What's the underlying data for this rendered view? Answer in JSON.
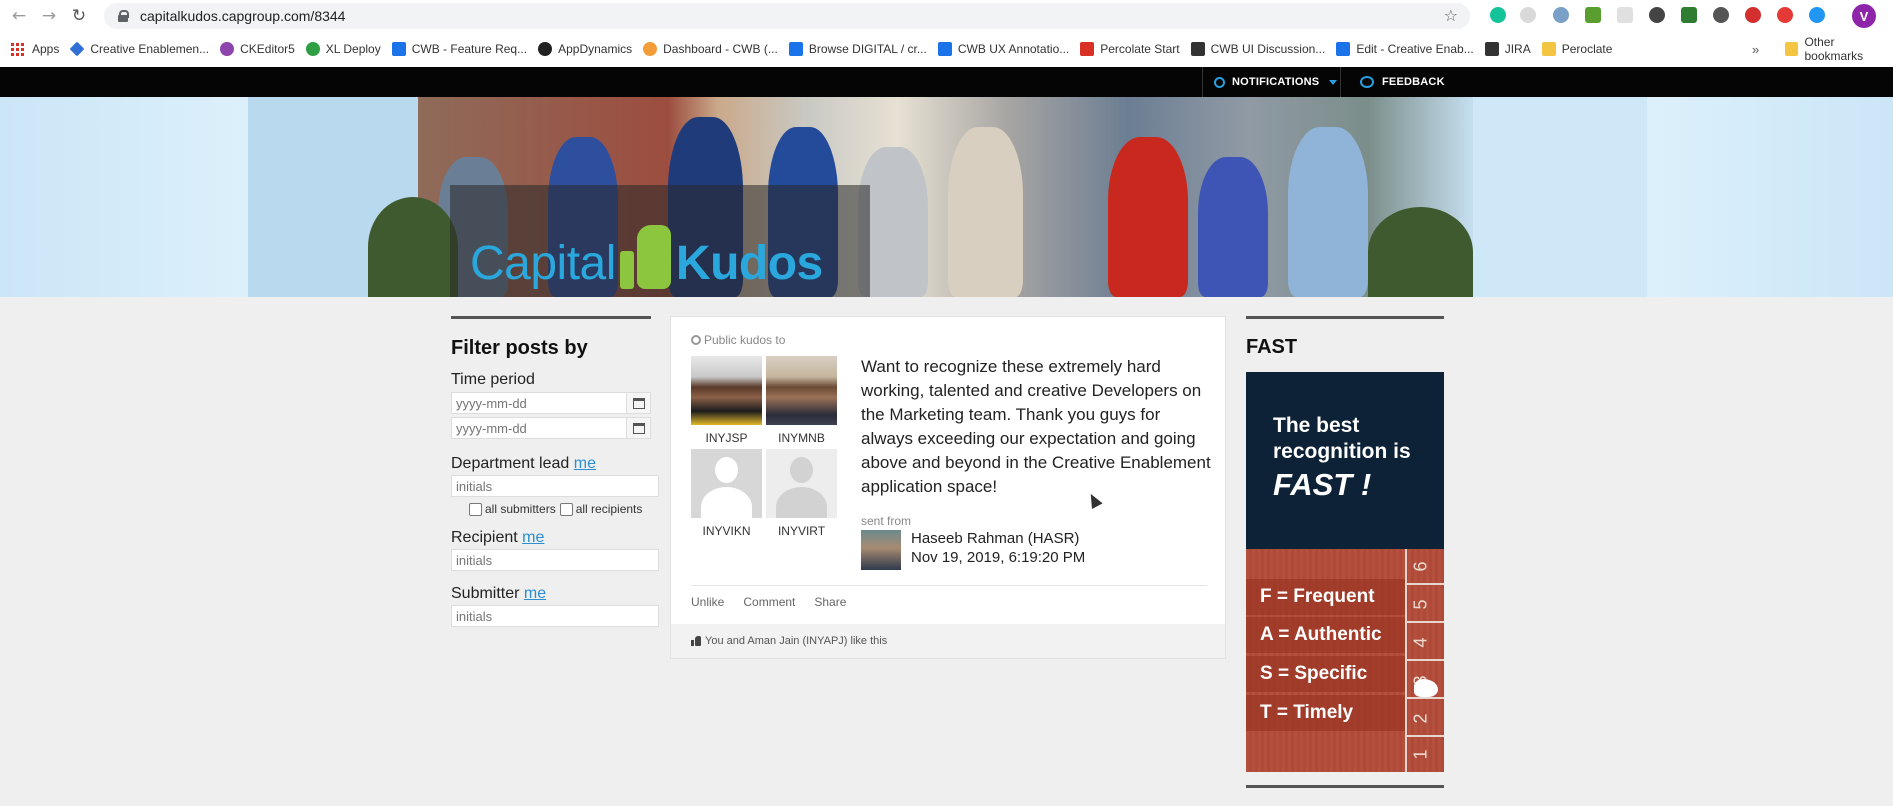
{
  "browser": {
    "url": "capitalkudos.capgroup.com/8344",
    "profile_initial": "V",
    "bookmarks": [
      {
        "label": "Apps",
        "color": "#d93025"
      },
      {
        "label": "Creative Enablemen...",
        "color": "#2f6fd6"
      },
      {
        "label": "CKEditor5",
        "color": "#8e44ad"
      },
      {
        "label": "XL Deploy",
        "color": "#2ea043"
      },
      {
        "label": "CWB - Feature Req...",
        "color": "#1a73e8"
      },
      {
        "label": "AppDynamics",
        "color": "#222222"
      },
      {
        "label": "Dashboard - CWB (...",
        "color": "#f29d38"
      },
      {
        "label": "Browse DIGITAL / cr...",
        "color": "#1a73e8"
      },
      {
        "label": "CWB UX Annotatio...",
        "color": "#1a73e8"
      },
      {
        "label": "Percolate Start",
        "color": "#d93025"
      },
      {
        "label": "CWB UI Discussion...",
        "color": "#333333"
      },
      {
        "label": "Edit - Creative Enab...",
        "color": "#1a73e8"
      },
      {
        "label": "JIRA",
        "color": "#333333"
      },
      {
        "label": "Peroclate",
        "color": "#f4c542"
      }
    ],
    "more_bookmarks": "»",
    "other_bookmarks": "Other bookmarks"
  },
  "topbar": {
    "notifications": "NOTIFICATIONS",
    "feedback": "FEEDBACK"
  },
  "banner": {
    "logo_capital": "Capital",
    "logo_kudos": "Kudos"
  },
  "filter": {
    "title": "Filter posts by",
    "time_period_label": "Time period",
    "date_from_placeholder": "yyyy-mm-dd",
    "date_to_placeholder": "yyyy-mm-dd",
    "dept_lead_label": "Department lead",
    "me_link": "me",
    "initials_placeholder": "initials",
    "all_submitters": "all submitters",
    "all_recipients": "all recipients",
    "recipient_label": "Recipient",
    "submitter_label": "Submitter"
  },
  "post": {
    "visibility": "Public kudos to",
    "recipients": [
      {
        "name": "INYJSP"
      },
      {
        "name": "INYMNB"
      },
      {
        "name": "INYVIKN"
      },
      {
        "name": "INYVIRT"
      }
    ],
    "message": "Want to recognize these extremely hard working, talented and creative Developers on the Marketing team. Thank you guys for always exceeding our expectation and going above and beyond in the Creative Enablement application space!",
    "sent_from_label": "sent from",
    "sender_name": "Haseeb Rahman (HASR)",
    "sent_date": "Nov 19, 2019, 6:19:20 PM",
    "actions": {
      "unlike": "Unlike",
      "comment": "Comment",
      "share": "Share"
    },
    "likes_text": "You and Aman Jain (INYAPJ) like this"
  },
  "sidebar": {
    "title": "FAST",
    "line1": "The best",
    "line2": "recognition is",
    "line3": "FAST !",
    "acronym": [
      "F = Frequent",
      "A = Authentic",
      "S = Specific",
      "T = Timely"
    ],
    "lanes": [
      "6",
      "5",
      "4",
      "3",
      "2",
      "1"
    ]
  }
}
